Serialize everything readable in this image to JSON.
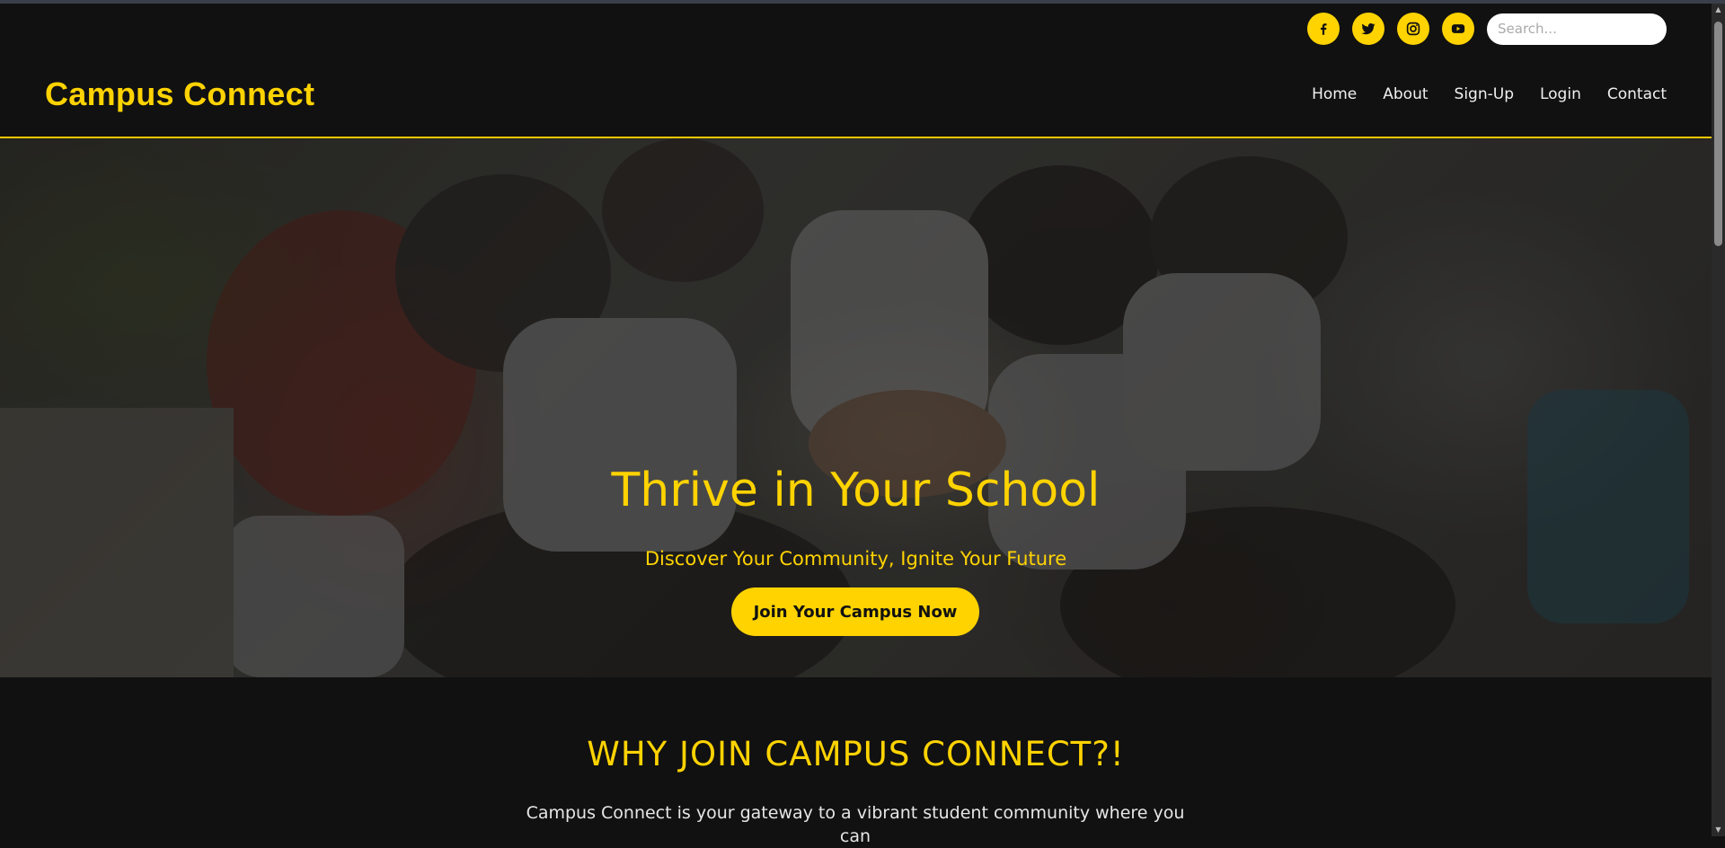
{
  "header": {
    "logo": "Campus Connect",
    "social": [
      {
        "icon": "facebook-icon"
      },
      {
        "icon": "twitter-icon"
      },
      {
        "icon": "instagram-icon"
      },
      {
        "icon": "youtube-icon"
      }
    ],
    "search_placeholder": "Search...",
    "nav": [
      "Home",
      "About",
      "Sign-Up",
      "Login",
      "Contact"
    ]
  },
  "hero": {
    "title": "Thrive in Your School",
    "subtitle": "Discover Your Community, Ignite Your Future",
    "cta_label": "Join Your Campus Now"
  },
  "why": {
    "heading": "WHY JOIN CAMPUS CONNECT?!",
    "text": "Campus Connect is your gateway to a vibrant student community where you can"
  },
  "colors": {
    "accent": "#ffd300",
    "background": "#111111",
    "nav_text": "#f0f0f0"
  }
}
